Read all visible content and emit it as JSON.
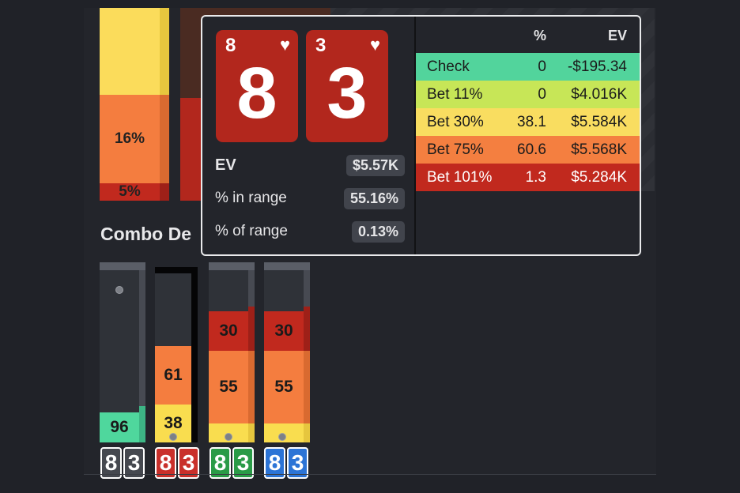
{
  "top_bars": {
    "bar1": {
      "seg_orange": "16%",
      "seg_red": "5%"
    }
  },
  "combo": {
    "title": "Combo De",
    "columns": [
      {
        "segments": [
          {
            "label": "96",
            "color": "#4fd79d"
          }
        ],
        "cards": [
          "8",
          "3"
        ],
        "card_color": "#45484f"
      },
      {
        "segments": [
          {
            "label": "38",
            "color": "#f9dd4f"
          },
          {
            "label": "61",
            "color": "#f47d3f"
          }
        ],
        "cards": [
          "8",
          "3"
        ],
        "card_color": "#c9302b"
      },
      {
        "segments": [
          {
            "label": "55",
            "color": "#f47d3f"
          },
          {
            "label": "30",
            "color": "#c1291e"
          }
        ],
        "cards": [
          "8",
          "3"
        ],
        "card_color": "#2a9b47"
      },
      {
        "segments": [
          {
            "label": "55",
            "color": "#f47d3f"
          },
          {
            "label": "30",
            "color": "#c1291e"
          }
        ],
        "cards": [
          "8",
          "3"
        ],
        "card_color": "#2c74d6"
      }
    ]
  },
  "popup": {
    "cards": [
      {
        "rank": "8",
        "suit": "♥"
      },
      {
        "rank": "3",
        "suit": "♥"
      }
    ],
    "stats": {
      "ev_label": "EV",
      "ev_value": "$5.57K",
      "in_range_label": "% in range",
      "in_range_value": "55.16%",
      "of_range_label": "% of range",
      "of_range_value": "0.13%"
    },
    "table": {
      "header_pct": "%",
      "header_ev": "EV",
      "rows": [
        {
          "name": "Check",
          "pct": "0",
          "ev": "-$195.34",
          "color": "#52d49c"
        },
        {
          "name": "Bet 11%",
          "pct": "0",
          "ev": "$4.016K",
          "color": "#c7e657"
        },
        {
          "name": "Bet 30%",
          "pct": "38.1",
          "ev": "$5.584K",
          "color": "#f9dd60"
        },
        {
          "name": "Bet 75%",
          "pct": "60.6",
          "ev": "$5.568K",
          "color": "#f47f40"
        },
        {
          "name": "Bet 101%",
          "pct": "1.3",
          "ev": "$5.284K",
          "color": "#c1291e"
        }
      ]
    }
  }
}
